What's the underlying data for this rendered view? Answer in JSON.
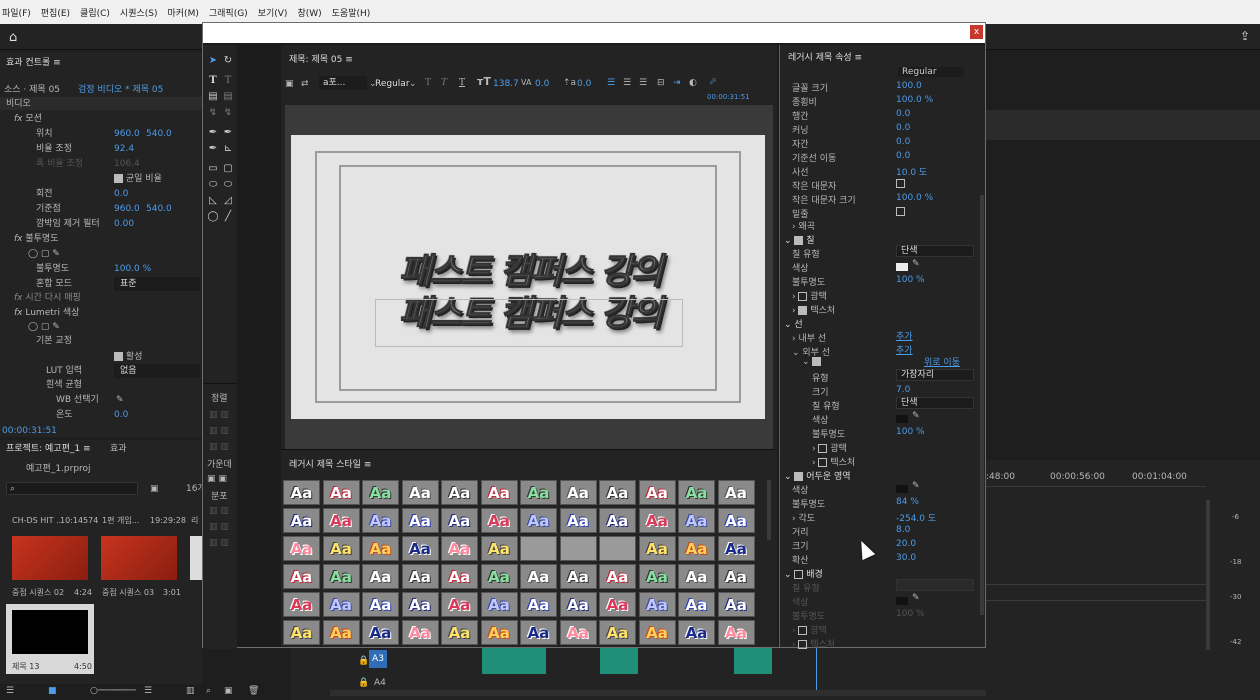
{
  "menu": [
    "파일(F)",
    "편집(E)",
    "클립(C)",
    "시퀀스(S)",
    "마커(M)",
    "그래픽(G)",
    "보기(V)",
    "창(W)",
    "도움말(H)"
  ],
  "effect_controls": {
    "tab": "효과 컨트롤",
    "source_label": "소스 · 제목 05",
    "sequence_label": "검정 비디오 * 제목 05",
    "video_label": "비디오",
    "motion": "모션",
    "position_label": "위치",
    "position_x": "960.0",
    "position_y": "540.0",
    "scale_label": "비율 조정",
    "scale_value": "92.4",
    "scale_w_label": "폭 비율 조정",
    "scale_w_value": "106.4",
    "uniform_scale": "균일 비율",
    "rotation_label": "회전",
    "rotation_value": "0.0",
    "anchor_label": "기준점",
    "anchor_x": "960.0",
    "anchor_y": "540.0",
    "flicker_label": "깜박임 제거 필터",
    "flicker_value": "0.00",
    "opacity": "불투명도",
    "opacity_label": "불투명도",
    "opacity_value": "100.0 %",
    "blend_label": "혼합 모드",
    "blend_value": "표준",
    "time_remap": "시간 다시 매핑",
    "lumetri": "Lumetri 색상",
    "basic_correction": "기본 교정",
    "active_label": "활성",
    "lut_label": "LUT 입력",
    "lut_value": "없음",
    "wb_label": "흰색 균형",
    "wb_picker": "WB 선택기",
    "temp_label": "온도",
    "temp_value": "0.0",
    "timecode": "00:00:31:51"
  },
  "project": {
    "tab": "프로젝트: 예고편_1",
    "tab2": "효과",
    "file": "예고편_1.prproj",
    "count": "16개",
    "items": [
      {
        "name": "CH-DS HIT ...",
        "dur": "10:14574"
      },
      {
        "name": "1편 개임...",
        "dur": "19:29:28"
      },
      {
        "name": "리",
        "dur": ""
      }
    ],
    "thumbs": [
      {
        "name": "중점 시퀀스 02",
        "dur": "4:24"
      },
      {
        "name": "중점 시퀀스 03",
        "dur": "3:01"
      },
      {
        "name": "제목 13",
        "dur": "4:50"
      }
    ]
  },
  "dialog": {
    "title_tab": "제목: 제목 05",
    "font": "a포...",
    "style": "Regular",
    "font_size": "138.7",
    "kerning": "0.0",
    "baseline": "0.0",
    "timecode": "00:00:31:51",
    "title_text_line1": "패스트 캠퍼스 강의",
    "title_text_line2": "패스트 캠퍼스 강의",
    "align_label": "정렬",
    "center_label": "가운데",
    "distribute_label": "분포",
    "styles_tab": "레거시 제목 스타일",
    "style_sample": "Aa"
  },
  "properties": {
    "tab": "레거시 제목 속성",
    "font_style_value": "Regular",
    "rows": [
      {
        "label": "글꼴 크기",
        "value": "100.0"
      },
      {
        "label": "종횡비",
        "value": "100.0 %"
      },
      {
        "label": "행간",
        "value": "0.0"
      },
      {
        "label": "커닝",
        "value": "0.0"
      },
      {
        "label": "자간",
        "value": "0.0"
      },
      {
        "label": "기준선 이동",
        "value": "0.0"
      },
      {
        "label": "사선",
        "value": "10.0 도"
      },
      {
        "label": "작은 대문자",
        "value": ""
      },
      {
        "label": "작은 대문자 크기",
        "value": "100.0 %"
      },
      {
        "label": "밑줄",
        "value": ""
      }
    ],
    "distort": "왜곡",
    "fill": "칠",
    "fill_type_label": "칠 유형",
    "fill_type_value": "단색",
    "color_label": "색상",
    "fill_opacity_label": "불투명도",
    "fill_opacity_value": "100 %",
    "sheen": "광택",
    "texture": "텍스처",
    "stroke": "선",
    "inner_stroke": "내부 선",
    "add1": "추가",
    "outer_stroke": "외부 선",
    "add2": "추가",
    "move_up": "위로 이동",
    "type_label": "유형",
    "type_value": "가장자리",
    "size_label": "크기",
    "size_value": "7.0",
    "stroke_fill_label": "칠 유형",
    "stroke_fill_value": "단색",
    "stroke_color_label": "색상",
    "stroke_opacity_label": "불투명도",
    "stroke_opacity_value": "100 %",
    "sheen2": "광택",
    "texture2": "텍스처",
    "shadow": "어두운 영역",
    "shadow_color_label": "색상",
    "shadow_opacity_label": "불투명도",
    "shadow_opacity_value": "84 %",
    "angle_label": "각도",
    "angle_value": "-254.0 도",
    "distance_label": "거리",
    "distance_value": "8.0",
    "shadow_size_label": "크기",
    "shadow_size_value": "20.0",
    "spread_label": "확산",
    "spread_value": "30.0",
    "background": "배경",
    "bg_fill_label": "칠 유형",
    "bg_color_label": "색상",
    "bg_opacity_label": "불투명도",
    "bg_opacity_value": "100 %",
    "bg_sheen": "광택",
    "bg_texture": "텍스처"
  },
  "timeline": {
    "tc1": ":48:00",
    "tc2": "00:00:56:00",
    "tc3": "00:01:04:00",
    "track_a3": "A3",
    "track_a4": "A4"
  }
}
